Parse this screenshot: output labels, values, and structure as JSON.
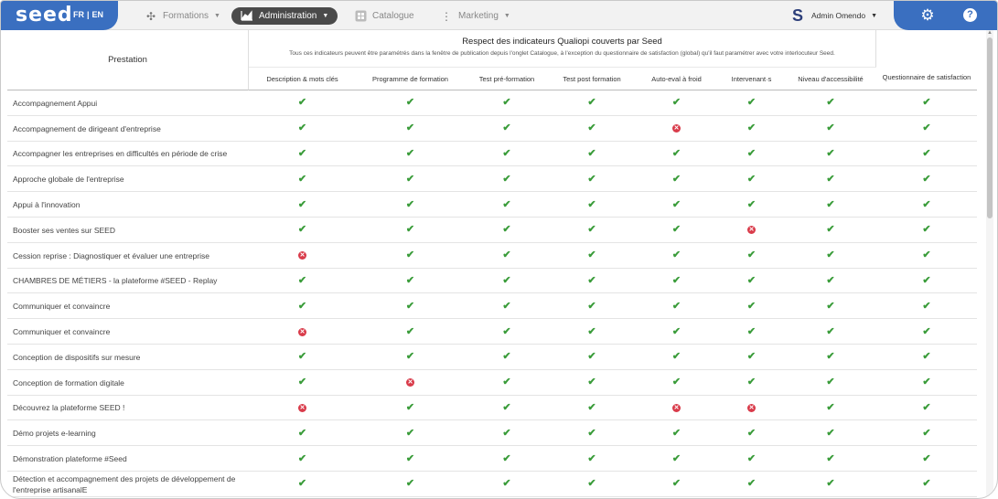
{
  "app": {
    "logo": "seed",
    "lang_fr": "FR",
    "lang_sep": "|",
    "lang_en": "EN"
  },
  "nav": [
    {
      "label": "Formations",
      "icon": "puzzle-icon",
      "active": false
    },
    {
      "label": "Administration",
      "icon": "chart-icon",
      "active": true
    },
    {
      "label": "Catalogue",
      "icon": "grid-icon",
      "active": false
    },
    {
      "label": "Marketing",
      "icon": "dots-vertical-icon",
      "active": false
    }
  ],
  "user": {
    "name": "Admin Omendo"
  },
  "colors": {
    "brand": "#3a6fc0",
    "ok": "#3a9c3a",
    "ko": "#d93b4a",
    "active_nav": "#4a4a4a"
  },
  "table": {
    "prestation_header": "Prestation",
    "group_title": "Respect des indicateurs Qualiopi couverts par Seed",
    "group_subtitle": "Tous ces indicateurs peuvent être paramétrés dans la fenêtre de publication depuis l'onglet Catalogue, à l'exception du questionnaire de satisfaction (global) qu'il faut paramétrer avec votre interlocuteur Seed.",
    "columns": [
      "Description & mots clés",
      "Programme de formation",
      "Test pré-formation",
      "Test post formation",
      "Auto-eval à froid",
      "Intervenant·s",
      "Niveau d'accessibilité",
      "Questionnaire de satisfaction"
    ],
    "rows": [
      {
        "name": "Accompagnement Appui",
        "values": [
          true,
          true,
          true,
          true,
          true,
          true,
          true,
          true
        ]
      },
      {
        "name": "Accompagnement de dirigeant d'entreprise",
        "values": [
          true,
          true,
          true,
          true,
          false,
          true,
          true,
          true
        ]
      },
      {
        "name": "Accompagner les entreprises en difficultés en période de crise",
        "values": [
          true,
          true,
          true,
          true,
          true,
          true,
          true,
          true
        ]
      },
      {
        "name": "Approche globale de l'entreprise",
        "values": [
          true,
          true,
          true,
          true,
          true,
          true,
          true,
          true
        ]
      },
      {
        "name": "Appui à l'innovation",
        "values": [
          true,
          true,
          true,
          true,
          true,
          true,
          true,
          true
        ]
      },
      {
        "name": "Booster ses ventes sur SEED",
        "values": [
          true,
          true,
          true,
          true,
          true,
          false,
          true,
          true
        ]
      },
      {
        "name": "Cession reprise : Diagnostiquer et évaluer une entreprise",
        "values": [
          false,
          true,
          true,
          true,
          true,
          true,
          true,
          true
        ]
      },
      {
        "name": "CHAMBRES DE MÉTIERS - la plateforme #SEED - Replay",
        "values": [
          true,
          true,
          true,
          true,
          true,
          true,
          true,
          true
        ]
      },
      {
        "name": "Communiquer et convaincre",
        "values": [
          true,
          true,
          true,
          true,
          true,
          true,
          true,
          true
        ]
      },
      {
        "name": "Communiquer et convaincre",
        "values": [
          false,
          true,
          true,
          true,
          true,
          true,
          true,
          true
        ]
      },
      {
        "name": "Conception de dispositifs sur mesure",
        "values": [
          true,
          true,
          true,
          true,
          true,
          true,
          true,
          true
        ]
      },
      {
        "name": "Conception de formation digitale",
        "values": [
          true,
          false,
          true,
          true,
          true,
          true,
          true,
          true
        ]
      },
      {
        "name": "Découvrez la plateforme SEED !",
        "values": [
          false,
          true,
          true,
          true,
          false,
          false,
          true,
          true
        ]
      },
      {
        "name": "Démo projets e-learning",
        "values": [
          true,
          true,
          true,
          true,
          true,
          true,
          true,
          true
        ]
      },
      {
        "name": "Démonstration plateforme #Seed",
        "values": [
          true,
          true,
          true,
          true,
          true,
          true,
          true,
          true
        ]
      },
      {
        "name": "Détection et accompagnement des projets de développement de l'entreprise artisanalE",
        "values": [
          true,
          true,
          true,
          true,
          true,
          true,
          true,
          true
        ]
      }
    ]
  }
}
